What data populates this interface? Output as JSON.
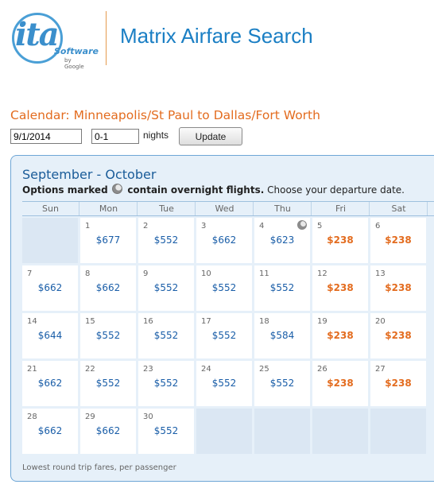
{
  "header": {
    "logo_text": "ita",
    "logo_sub": "Software",
    "logo_by": "by Google",
    "app_title": "Matrix Airfare Search"
  },
  "form": {
    "heading": "Calendar: Minneapolis/St Paul to Dallas/Fort Worth",
    "date_value": "9/1/2014",
    "nights_value": "0-1",
    "nights_label": "nights",
    "update_label": "Update"
  },
  "calendar": {
    "month_title": "September - October",
    "options_bold": "Options marked",
    "options_bold2": "contain overnight flights.",
    "options_rest": "Choose your departure date.",
    "day_headers": [
      "Sun",
      "Mon",
      "Tue",
      "Wed",
      "Thu",
      "Fri",
      "Sat"
    ],
    "footer_note": "Lowest round trip fares, per passenger",
    "colors": {
      "cheap": "#e36c1f",
      "regular": "#1a5ea8"
    },
    "weeks": [
      [
        {
          "blank": true
        },
        {
          "day": "1",
          "price": "$677"
        },
        {
          "day": "2",
          "price": "$552"
        },
        {
          "day": "3",
          "price": "$662"
        },
        {
          "day": "4",
          "price": "$623",
          "overnight": true
        },
        {
          "day": "5",
          "price": "$238",
          "cheap": true
        },
        {
          "day": "6",
          "price": "$238",
          "cheap": true
        }
      ],
      [
        {
          "day": "7",
          "price": "$662"
        },
        {
          "day": "8",
          "price": "$662"
        },
        {
          "day": "9",
          "price": "$552"
        },
        {
          "day": "10",
          "price": "$552"
        },
        {
          "day": "11",
          "price": "$552"
        },
        {
          "day": "12",
          "price": "$238",
          "cheap": true
        },
        {
          "day": "13",
          "price": "$238",
          "cheap": true
        }
      ],
      [
        {
          "day": "14",
          "price": "$644"
        },
        {
          "day": "15",
          "price": "$552"
        },
        {
          "day": "16",
          "price": "$552"
        },
        {
          "day": "17",
          "price": "$552"
        },
        {
          "day": "18",
          "price": "$584"
        },
        {
          "day": "19",
          "price": "$238",
          "cheap": true
        },
        {
          "day": "20",
          "price": "$238",
          "cheap": true
        }
      ],
      [
        {
          "day": "21",
          "price": "$662"
        },
        {
          "day": "22",
          "price": "$552"
        },
        {
          "day": "23",
          "price": "$552"
        },
        {
          "day": "24",
          "price": "$552"
        },
        {
          "day": "25",
          "price": "$552"
        },
        {
          "day": "26",
          "price": "$238",
          "cheap": true
        },
        {
          "day": "27",
          "price": "$238",
          "cheap": true
        }
      ],
      [
        {
          "day": "28",
          "price": "$662"
        },
        {
          "day": "29",
          "price": "$662"
        },
        {
          "day": "30",
          "price": "$552"
        },
        {
          "blank": true
        },
        {
          "blank": true
        },
        {
          "blank": true
        },
        {
          "blank": true
        }
      ]
    ]
  }
}
